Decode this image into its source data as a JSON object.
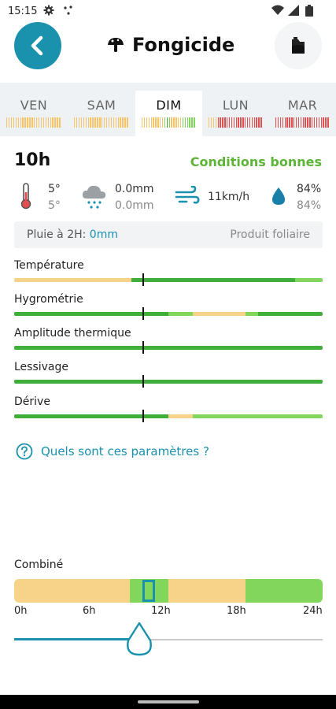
{
  "status_bar": {
    "time": "15:15"
  },
  "header": {
    "title": "Fongicide"
  },
  "day_tabs": [
    {
      "label": "VEN",
      "bar": [
        "#f7c46a",
        "#f7c46a",
        "#f7c46a",
        "#f7c46a",
        "#f7c46a",
        "#f7c46a",
        "#f7c46a",
        "#f7c46a",
        "#f7c46a",
        "#f7c46a",
        "#f7c46a",
        "#f7c46a",
        "#f7c46a",
        "#f7c46a",
        "#f7c46a",
        "#f7c46a",
        "#f7c46a",
        "#f7c46a",
        "#f7c46a",
        "#f7c46a",
        "#f7c46a",
        "#f7c46a",
        "#f7c46a",
        "#f7c46a"
      ]
    },
    {
      "label": "SAM",
      "bar": [
        "#f7c46a",
        "#f7c46a",
        "#f7c46a",
        "#f7c46a",
        "#f7c46a",
        "#f7c46a",
        "#f7c46a",
        "#f7c46a",
        "#f7c46a",
        "#f7c46a",
        "#f7c46a",
        "#f7c46a",
        "#f7c46a",
        "#f7c46a",
        "#f7c46a",
        "#f7c46a",
        "#f7c46a",
        "#f7c46a",
        "#f7c46a",
        "#f7c46a",
        "#f7c46a",
        "#f7c46a",
        "#f7c46a",
        "#f7c46a"
      ]
    },
    {
      "label": "DIM",
      "active": true,
      "bar": [
        "#f7c46a",
        "#f7c46a",
        "#f7c46a",
        "#f7c46a",
        "#f7c46a",
        "#f7c46a",
        "#f7c46a",
        "#f7c46a",
        "#f7c46a",
        "#f7c46a",
        "#82d65c",
        "#3fae3a",
        "#82d65c",
        "#f7c46a",
        "#f7c46a",
        "#f7c46a",
        "#f7c46a",
        "#f7c46a",
        "#82d65c",
        "#82d65c",
        "#82d65c",
        "#82d65c",
        "#82d65c",
        "#82d65c"
      ]
    },
    {
      "label": "LUN",
      "bar": [
        "#f7c46a",
        "#f7c46a",
        "#f7c46a",
        "#f7c46a",
        "#e44e4e",
        "#e44e4e",
        "#e44e4e",
        "#e44e4e",
        "#e44e4e",
        "#e44e4e",
        "#e44e4e",
        "#e44e4e",
        "#e44e4e",
        "#e44e4e",
        "#e44e4e",
        "#e44e4e",
        "#e44e4e",
        "#e44e4e",
        "#e44e4e",
        "#e44e4e",
        "#e44e4e",
        "#e44e4e",
        "#e44e4e",
        "#e44e4e"
      ]
    },
    {
      "label": "MAR",
      "bar": [
        "#e44e4e",
        "#e44e4e",
        "#e44e4e",
        "#e44e4e",
        "#e44e4e",
        "#e44e4e",
        "#e44e4e",
        "#e44e4e",
        "#e44e4e",
        "#e44e4e",
        "#e44e4e",
        "#e44e4e",
        "#e44e4e",
        "#e44e4e",
        "#e44e4e",
        "#e44e4e",
        "#e44e4e",
        "#e44e4e",
        "#e44e4e",
        "#e44e4e",
        "#e44e4e",
        "#e44e4e",
        "#e44e4e",
        "#e44e4e"
      ]
    }
  ],
  "selected_hour": "10h",
  "condition": "Conditions bonnes",
  "metrics": {
    "temp_max": "5°",
    "temp_min": "5°",
    "rain_1": "0.0mm",
    "rain_2": "0.0mm",
    "wind": "11km/h",
    "humidity_1": "84%",
    "humidity_2": "84%"
  },
  "rain_info": {
    "label": "Pluie à 2H: ",
    "value": "0mm",
    "product": "Produit foliaire"
  },
  "parameters": [
    {
      "label": "Température",
      "segments": [
        {
          "color": "#f7d38a",
          "frac": 0.38
        },
        {
          "color": "#3fae3a",
          "frac": 0.53
        },
        {
          "color": "#82d65c",
          "frac": 0.09
        }
      ]
    },
    {
      "label": "Hygrométrie",
      "segments": [
        {
          "color": "#3fae3a",
          "frac": 0.5
        },
        {
          "color": "#82d65c",
          "frac": 0.08
        },
        {
          "color": "#f7d38a",
          "frac": 0.17
        },
        {
          "color": "#82d65c",
          "frac": 0.04
        },
        {
          "color": "#3fae3a",
          "frac": 0.21
        }
      ]
    },
    {
      "label": "Amplitude thermique",
      "segments": [
        {
          "color": "#3fae3a",
          "frac": 1
        }
      ]
    },
    {
      "label": "Lessivage",
      "segments": [
        {
          "color": "#3fae3a",
          "frac": 1
        }
      ]
    },
    {
      "label": "Dérive",
      "segments": [
        {
          "color": "#3fae3a",
          "frac": 0.5
        },
        {
          "color": "#f7d38a",
          "frac": 0.08
        },
        {
          "color": "#82d65c",
          "frac": 0.42
        }
      ]
    }
  ],
  "help_text": "Quels sont ces paramètres ?",
  "combined": {
    "label": "Combiné",
    "segments": [
      {
        "color": "#f7d38a",
        "frac": 0.375
      },
      {
        "color": "#82d65c",
        "frac": 0.125
      },
      {
        "color": "#f7d38a",
        "frac": 0.25
      },
      {
        "color": "#82d65c",
        "frac": 0.25
      }
    ],
    "hours": [
      "0h",
      "6h",
      "12h",
      "18h",
      "24h"
    ],
    "selected_fraction": 0.417
  },
  "colors": {
    "accent": "#1a92ad",
    "good": "#5cb537"
  }
}
